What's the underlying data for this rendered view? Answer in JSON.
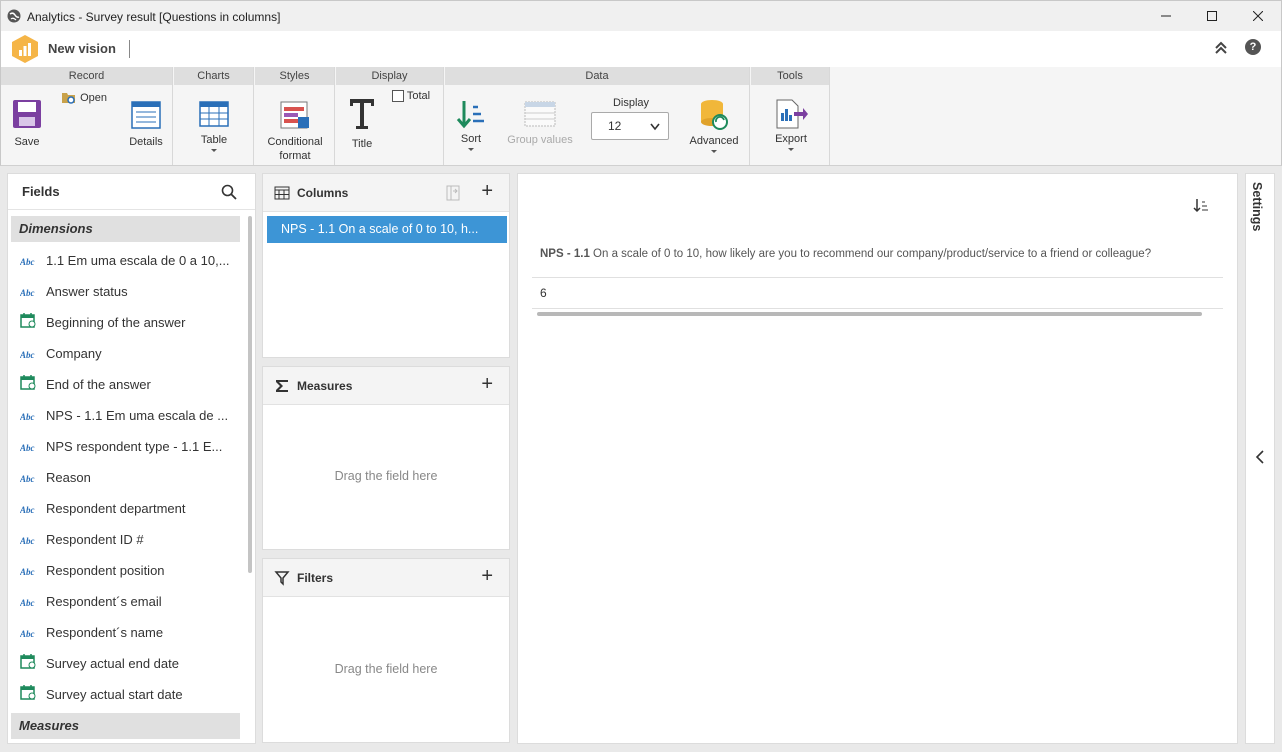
{
  "window": {
    "title": "Analytics - Survey result [Questions in columns]"
  },
  "vision": {
    "title": "New vision",
    "help": "?"
  },
  "ribbon": {
    "groups": {
      "record": "Record",
      "charts": "Charts",
      "styles": "Styles",
      "display": "Display",
      "data": "Data",
      "tools": "Tools"
    },
    "buttons": {
      "save": "Save",
      "open": "Open",
      "details": "Details",
      "table": "Table",
      "conditional_format_1": "Conditional",
      "conditional_format_2": "format",
      "title": "Title",
      "total": "Total",
      "sort": "Sort",
      "group_values": "Group values",
      "display_label": "Display",
      "display_value": "12",
      "advanced": "Advanced",
      "export": "Export"
    }
  },
  "fields": {
    "title": "Fields",
    "dimensions_label": "Dimensions",
    "measures_label": "Measures",
    "items": [
      {
        "label": "1.1 Em uma escala de 0 a 10,...",
        "type": "text"
      },
      {
        "label": "Answer status",
        "type": "text"
      },
      {
        "label": "Beginning of the answer",
        "type": "date"
      },
      {
        "label": "Company",
        "type": "text"
      },
      {
        "label": "End of the answer",
        "type": "date"
      },
      {
        "label": "NPS - 1.1 Em uma escala de ...",
        "type": "text"
      },
      {
        "label": "NPS respondent type - 1.1 E...",
        "type": "text"
      },
      {
        "label": "Reason",
        "type": "text"
      },
      {
        "label": "Respondent department",
        "type": "text"
      },
      {
        "label": "Respondent ID #",
        "type": "text"
      },
      {
        "label": "Respondent position",
        "type": "text"
      },
      {
        "label": "Respondent´s email",
        "type": "text"
      },
      {
        "label": "Respondent´s name",
        "type": "text"
      },
      {
        "label": "Survey actual end date",
        "type": "date"
      },
      {
        "label": "Survey actual start date",
        "type": "date"
      }
    ],
    "abc": "Abc"
  },
  "columns": {
    "title": "Columns",
    "chip": "NPS - 1.1 On a scale of 0 to 10, h..."
  },
  "measures": {
    "title": "Measures",
    "hint": "Drag the field here"
  },
  "filters": {
    "title": "Filters",
    "hint": "Drag the field here"
  },
  "result": {
    "header_prefix": "NPS - 1.1",
    "header_rest": " On a scale of 0 to 10, how likely are you to recommend our company/product/service to a friend or colleague?",
    "value": "6"
  },
  "settings": {
    "label": "Settings"
  },
  "colors": {
    "accent": "#3d95d6",
    "logo": "#f5b547",
    "save": "#7b3fa0",
    "sort": "#1e8a5c"
  }
}
